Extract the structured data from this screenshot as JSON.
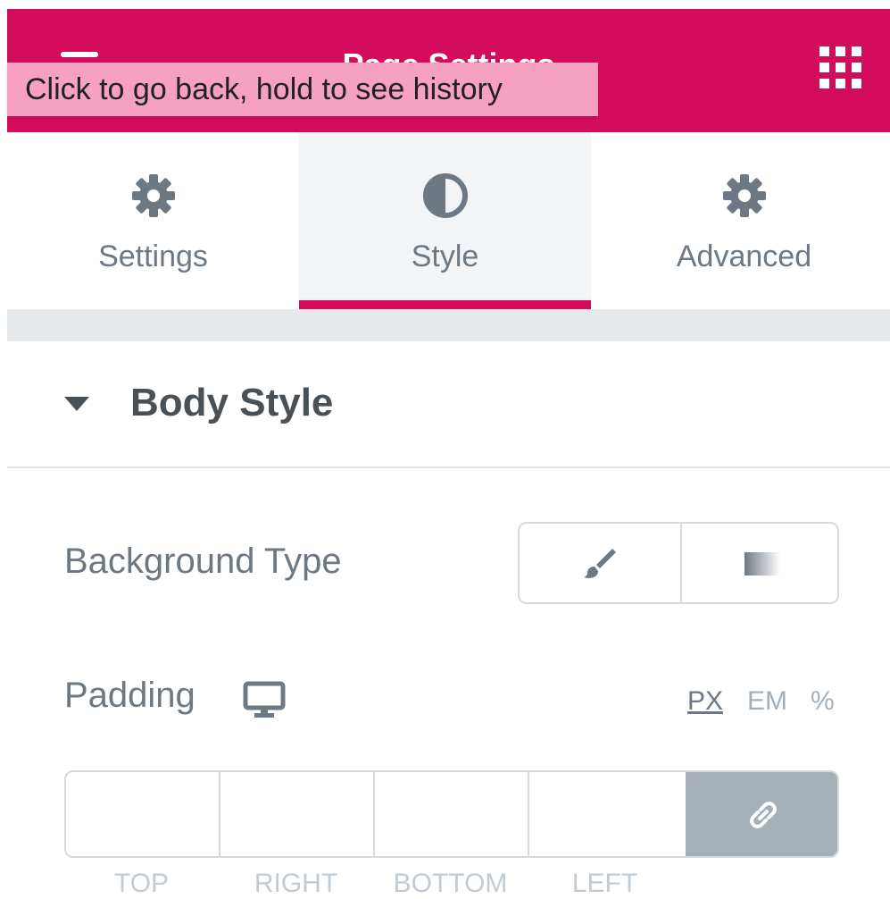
{
  "header": {
    "title": "Page Settings",
    "tooltip": "Click to go back, hold to see history",
    "menu_icon": "hamburger-icon",
    "apps_icon": "grid-icon"
  },
  "tabs": [
    {
      "label": "Settings",
      "icon": "gear-icon",
      "active": false
    },
    {
      "label": "Style",
      "icon": "half-circle-icon",
      "active": true
    },
    {
      "label": "Advanced",
      "icon": "gear-icon",
      "active": false
    }
  ],
  "section": {
    "title": "Body Style",
    "expanded": true
  },
  "background_type": {
    "label": "Background Type",
    "options": [
      {
        "name": "classic",
        "icon": "brush-icon"
      },
      {
        "name": "gradient",
        "icon": "gradient-icon"
      }
    ]
  },
  "padding": {
    "label": "Padding",
    "device_icon": "monitor-icon",
    "units": [
      "PX",
      "EM",
      "%"
    ],
    "active_unit": "PX",
    "fields": [
      {
        "label": "TOP",
        "value": ""
      },
      {
        "label": "RIGHT",
        "value": ""
      },
      {
        "label": "BOTTOM",
        "value": ""
      },
      {
        "label": "LEFT",
        "value": ""
      }
    ],
    "link_icon": "link-icon"
  },
  "colors": {
    "accent": "#d30c5c",
    "tooltip_bg": "#f6a1c2",
    "text": "#6d7882",
    "heading": "#495157",
    "muted": "#a4afb7"
  }
}
